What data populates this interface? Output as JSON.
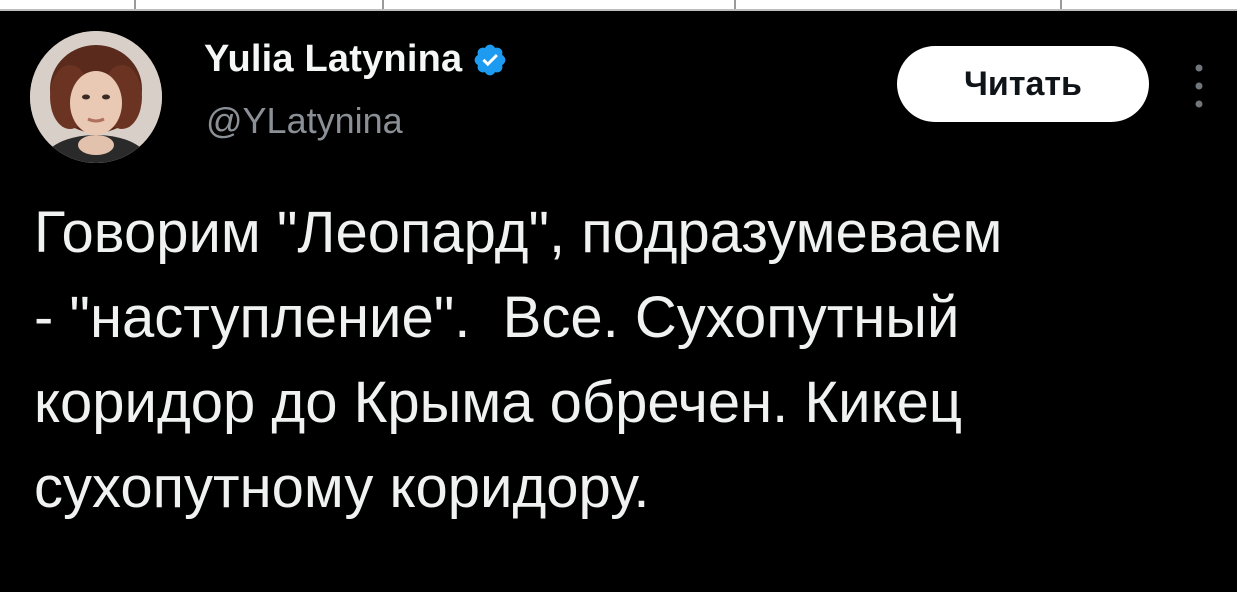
{
  "tweet": {
    "author": {
      "display_name": "Yulia Latynina",
      "handle": "@YLatynina",
      "verified": true,
      "avatar_icon": "profile-photo"
    },
    "follow_label": "Читать",
    "more_icon": "vertical-ellipsis-icon",
    "text_lines": [
      "Говорим \"Леопард\", подразумеваем",
      "- \"наступление\".  Все. Сухопутный",
      "коридор до Крыма обречен. Кикец",
      "сухопутному коридору."
    ]
  },
  "colors": {
    "background": "#000000",
    "text": "#e7e9ea",
    "secondary_text": "#8b9096",
    "verified_badge": "#1d9bf0",
    "follow_button_bg": "#ffffff",
    "follow_button_text": "#0f1419"
  }
}
